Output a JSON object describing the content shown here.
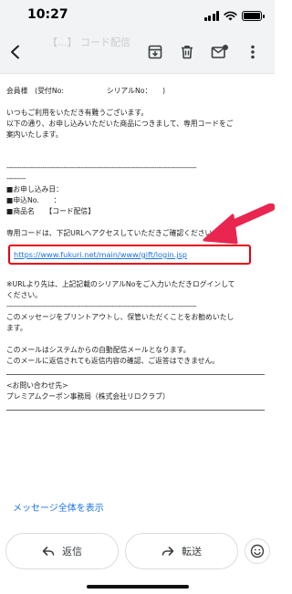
{
  "status_bar": {
    "time": "10:27"
  },
  "toolbar": {
    "back_icon": "arrow-left-icon",
    "archive_icon": "archive-icon",
    "delete_icon": "trash-icon",
    "mark_unread_icon": "mark-unread-icon",
    "more_icon": "more-vert-icon",
    "ghost_subject": "【...】 コード配信"
  },
  "email": {
    "header_line": "会員様　(受付No:　　　　　　シリアルNo：　　)",
    "greeting": "いつもご利用をいただき有難うございます。",
    "intro_1": "以下の通り、お申し込みいただいた商品につきまして、専用コードをご",
    "intro_2": "案内いたします。",
    "dash_line_1": "------------------------------------------------------------------------------------------",
    "dash_short": "---------",
    "order_date": "■お申し込み日：",
    "order_no": "■申込No.　　：",
    "product": "■商品名　　【コード配信】",
    "instruction": "専用コードは、下記URLへアクセスしていただきご確認ください。",
    "link": "https://www.fukuri.net/main/www/gift/login.jsp",
    "note_1": "※URLより先は、上記記載のシリアルNoをご入力いただきログインして",
    "note_2": "ください。",
    "dash_line_2": "------------------------------------------------------------------------------------------",
    "print_notice": "このメッセージをプリントアウトし、保管いただくことをお勧めいたし",
    "print_notice_2": "ます。",
    "auto_notice_1": "このメールはシステムからの自動配信メールとなります。",
    "auto_notice_2": "このメールに返信されても返信内容の確認、ご返答はできません。",
    "contact_title": "<お問い合わせ先>",
    "contact_org": "プレミアムクーポン事務局（株式会社リロクラブ）"
  },
  "show_full_message": "メッセージ全体を表示",
  "actions": {
    "reply_label": "返信",
    "forward_label": "転送",
    "reply_icon": "reply-icon",
    "forward_icon": "forward-icon",
    "emoji_icon": "emoji-icon"
  },
  "colors": {
    "accent_link": "#1a73e8",
    "highlight_red": "#e60012",
    "arrow_pink": "#e8264f"
  }
}
